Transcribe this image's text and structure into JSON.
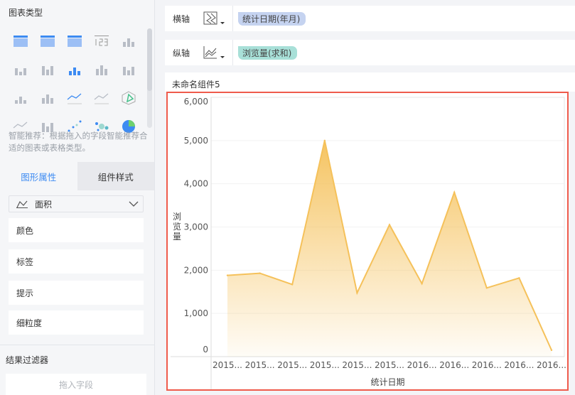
{
  "left_panel": {
    "chart_type_title": "图表类型",
    "chart_icons": [
      "cross-table-icon",
      "group-table-icon",
      "detail-table-icon",
      "kpi-number-icon",
      "kpi-card-icon",
      "indicator-list-icon",
      "heatmap-icon",
      "multi-bar-icon",
      "bar-chart-icon",
      "column-chart-icon",
      "stacked-bar-icon",
      "waterfall-icon",
      "multi-line-icon",
      "line-chart-icon",
      "radar-icon",
      "area-chart-icon",
      "combo-chart-icon",
      "scatter-icon",
      "bubble-icon",
      "pie-chart-icon"
    ],
    "hint": "智能推荐：根据拖入的字段智能推荐合适的图表或表格类型。",
    "tabs": [
      {
        "label": "图形属性",
        "active": true
      },
      {
        "label": "组件样式",
        "active": false
      }
    ],
    "mark_type": "面积",
    "properties": [
      "颜色",
      "标签",
      "提示",
      "细粒度"
    ],
    "filter_title": "结果过滤器",
    "filter_placeholder": "拖入字段"
  },
  "axes": {
    "x": {
      "label": "横轴",
      "field": "统计日期(年月)",
      "color": "#c5d3f0"
    },
    "y": {
      "label": "纵轴",
      "field": "浏览量(求和)",
      "color": "#a8e0d8"
    }
  },
  "component_title": "未命名组件5",
  "chart_data": {
    "type": "area",
    "categories": [
      "2015...",
      "2015...",
      "2015...",
      "2015...",
      "2015...",
      "2015...",
      "2016...",
      "2016...",
      "2016...",
      "2016...",
      "2016..."
    ],
    "values": [
      1880,
      1930,
      1670,
      5000,
      1475,
      3050,
      1690,
      3800,
      1590,
      1820,
      150
    ],
    "xlabel": "统计日期",
    "ylabel": "浏览量",
    "ylim": [
      0,
      6000
    ],
    "yticks": [
      "0",
      "1,000",
      "2,000",
      "3,000",
      "4,000",
      "5,000",
      "6,000"
    ],
    "color": "#f5c15a",
    "grid": true
  },
  "colors": {
    "accent": "#3d8bf2",
    "selection_border": "#ef5b4c"
  }
}
